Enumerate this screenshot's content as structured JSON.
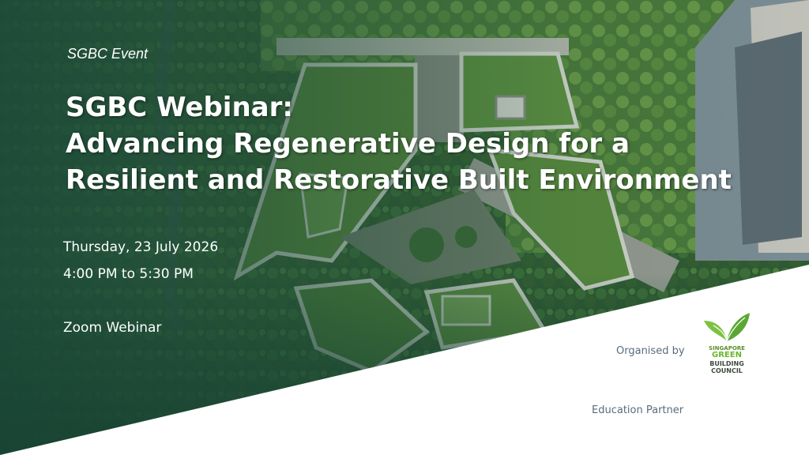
{
  "event_label": "SGBC Event",
  "title_lines": [
    "SGBC Webinar:",
    "Advancing Regenerative Design for a",
    "Resilient and Restorative Built Environment"
  ],
  "date": "Thursday, 23 July 2026",
  "time": "4:00 PM to 5:30 PM",
  "venue": "Zoom Webinar",
  "organised_by_label": "Organised by",
  "education_partner_label": "Education Partner",
  "logo": {
    "line1": "SINGAPORE",
    "line2": "GREEN",
    "line3": "BUILDING",
    "line4": "COUNCIL",
    "icon": "leaf-icon"
  },
  "colors": {
    "brand_green": "#6bb52b",
    "dark_green": "#1f4a37",
    "text_gray": "#5a6b7d"
  }
}
